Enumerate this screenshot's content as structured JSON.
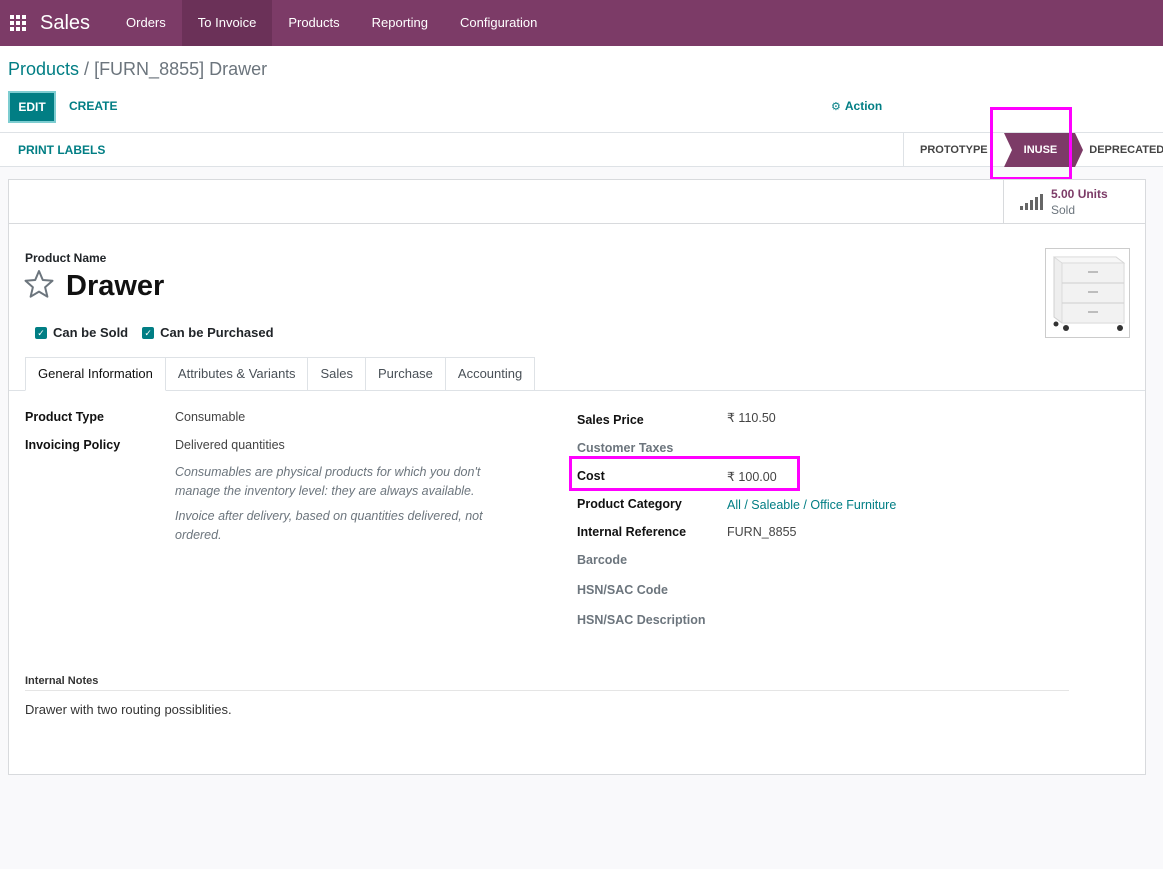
{
  "navbar": {
    "brand": "Sales",
    "items": [
      {
        "label": "Orders"
      },
      {
        "label": "To Invoice"
      },
      {
        "label": "Products"
      },
      {
        "label": "Reporting"
      },
      {
        "label": "Configuration"
      }
    ],
    "active_index": 1,
    "color": "#7c3b67"
  },
  "breadcrumb": {
    "parent": "Products",
    "separator": " / ",
    "current": "[FURN_8855] Drawer"
  },
  "control": {
    "edit_label": "EDIT",
    "create_label": "CREATE",
    "action_label": "Action"
  },
  "statusbar": {
    "print_labels": "PRINT LABELS",
    "stages": [
      "PROTOTYPE",
      "INUSE",
      "DEPRECATED"
    ],
    "active_stage": "INUSE"
  },
  "stat": {
    "value": "5.00 Units",
    "label": "Sold"
  },
  "product": {
    "name_label": "Product Name",
    "name": "Drawer",
    "can_be_sold": "Can be Sold",
    "can_be_purchased": "Can be Purchased"
  },
  "tabs": [
    "General Information",
    "Attributes & Variants",
    "Sales",
    "Purchase",
    "Accounting"
  ],
  "general": {
    "product_type_label": "Product Type",
    "product_type": "Consumable",
    "invoicing_policy_label": "Invoicing Policy",
    "invoicing_policy": "Delivered quantities",
    "help_consumable": "Consumables are physical products for which you don't manage the inventory level: they are always available.",
    "help_invoice": "Invoice after delivery, based on quantities delivered, not ordered.",
    "sales_price_label": "Sales Price",
    "sales_price": "₹ 110.50",
    "customer_taxes_label": "Customer Taxes",
    "cost_label": "Cost",
    "cost": "₹ 100.00",
    "category_label": "Product Category",
    "category": "All / Saleable / Office Furniture",
    "internal_ref_label": "Internal Reference",
    "internal_ref": "FURN_8855",
    "barcode_label": "Barcode",
    "hsn_code_label": "HSN/SAC Code",
    "hsn_desc_label": "HSN/SAC Description"
  },
  "notes": {
    "label": "Internal Notes",
    "text": "Drawer with two routing possiblities."
  },
  "accent": "#017e84",
  "highlight_color": "#ff00ff"
}
